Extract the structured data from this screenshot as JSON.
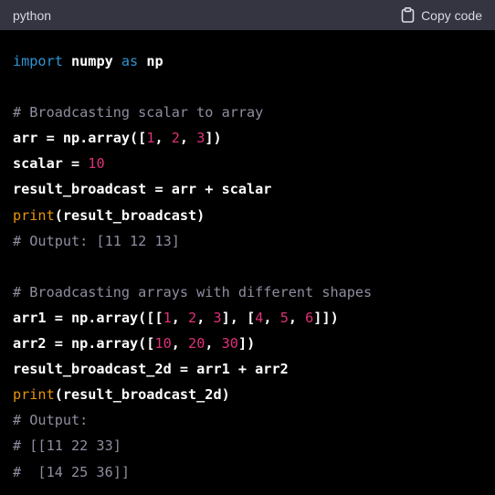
{
  "header": {
    "language": "python",
    "copy_label": "Copy code"
  },
  "colors": {
    "header_bg": "#343541",
    "code_bg": "#000000",
    "keyword": "#2e95d3",
    "comment": "#8e8ea0",
    "number": "#df3079",
    "builtin": "#e9950c",
    "text": "#ffffff"
  },
  "code": {
    "l1": {
      "kw1": "import",
      "t1": " numpy ",
      "kw2": "as",
      "t2": " np"
    },
    "l3": "# Broadcasting scalar to array",
    "l4": {
      "t1": "arr = np.array([",
      "n1": "1",
      "s1": ", ",
      "n2": "2",
      "s2": ", ",
      "n3": "3",
      "t2": "])"
    },
    "l5": {
      "t1": "scalar = ",
      "n1": "10"
    },
    "l6": "result_broadcast = arr + scalar",
    "l7": {
      "fn": "print",
      "t1": "(result_broadcast)"
    },
    "l8": "# Output: [11 12 13]",
    "l10": "# Broadcasting arrays with different shapes",
    "l11": {
      "t1": "arr1 = np.array([[",
      "n1": "1",
      "s1": ", ",
      "n2": "2",
      "s2": ", ",
      "n3": "3",
      "t2": "], [",
      "n4": "4",
      "s3": ", ",
      "n5": "5",
      "s4": ", ",
      "n6": "6",
      "t3": "]])"
    },
    "l12": {
      "t1": "arr2 = np.array([",
      "n1": "10",
      "s1": ", ",
      "n2": "20",
      "s2": ", ",
      "n3": "30",
      "t2": "])"
    },
    "l13": "result_broadcast_2d = arr1 + arr2",
    "l14": {
      "fn": "print",
      "t1": "(result_broadcast_2d)"
    },
    "l15": "# Output:",
    "l16": "# [[11 22 33]",
    "l17": "#  [14 25 36]]"
  }
}
